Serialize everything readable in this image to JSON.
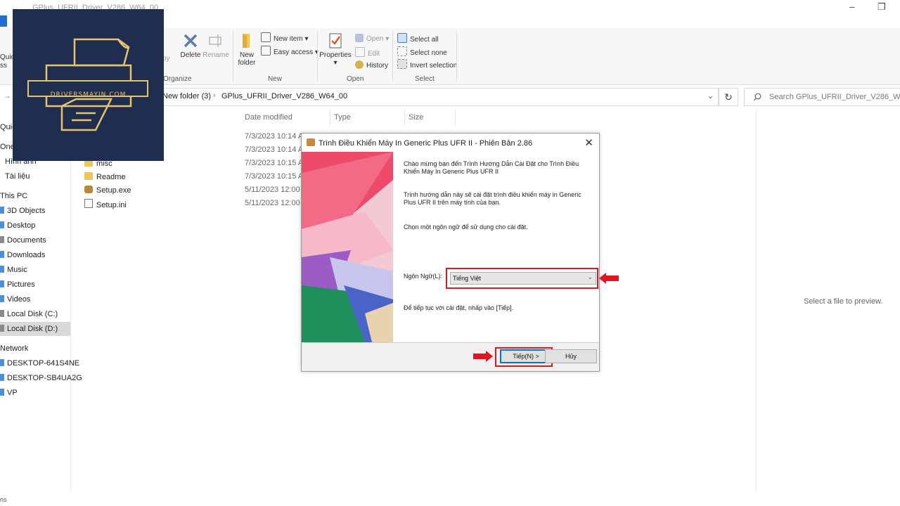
{
  "window": {
    "title": "GPlus_UFRII_Driver_V286_W64_00"
  },
  "ribbon": {
    "groups": {
      "organize": "Organize",
      "new": "New",
      "open": "Open",
      "select": "Select"
    },
    "quick_access": "Quick",
    "quick_access_2": "ss",
    "copy_partial": "py",
    "delete": "Delete",
    "rename": "Rename",
    "new_folder_1": "New",
    "new_folder_2": "folder",
    "new_item": "New item",
    "easy_access": "Easy access",
    "properties": "Properties",
    "open": "Open",
    "edit": "Edit",
    "history": "History",
    "select_all": "Select all",
    "select_none": "Select none",
    "invert_selection": "Invert selection"
  },
  "address": {
    "parent": "New folder (3)",
    "current": "GPlus_UFRII_Driver_V286_W64_00",
    "search_placeholder": "Search GPlus_UFRII_Driver_V286_W64_00"
  },
  "nav": {
    "items": [
      {
        "label": "Quic"
      },
      {
        "label": "One"
      },
      {
        "label": "Hình ảnh"
      },
      {
        "label": "Tài liệu"
      },
      {
        "label": "This PC"
      },
      {
        "label": "3D Objects"
      },
      {
        "label": "Desktop"
      },
      {
        "label": "Documents"
      },
      {
        "label": "Downloads"
      },
      {
        "label": "Music"
      },
      {
        "label": "Pictures"
      },
      {
        "label": "Videos"
      },
      {
        "label": "Local Disk (C:)"
      },
      {
        "label": "Local Disk (D:)"
      },
      {
        "label": "Network"
      },
      {
        "label": "DESKTOP-641S4NE"
      },
      {
        "label": "DESKTOP-SB4UA2G"
      },
      {
        "label": "VP"
      }
    ]
  },
  "files": {
    "columns": {
      "date": "Date modified",
      "type": "Type",
      "size": "Size"
    },
    "rows": [
      {
        "name": "",
        "date": "7/3/2023 10:14 A"
      },
      {
        "name": "",
        "date": "7/3/2023 10:14 A"
      },
      {
        "name": "misc",
        "date": "7/3/2023 10:15 A"
      },
      {
        "name": "Readme",
        "date": "7/3/2023 10:15 A"
      },
      {
        "name": "Setup.exe",
        "date": "5/11/2023 12:00 A"
      },
      {
        "name": "Setup.ini",
        "date": "5/11/2023 12:00 A"
      }
    ]
  },
  "preview": {
    "text": "Select a file to preview."
  },
  "status": {
    "text": "ns"
  },
  "logo": {
    "text": "DRIVERSMAYIN.COM"
  },
  "dialog": {
    "title": "Trình Điều Khiển Máy In Generic Plus UFR II - Phiên Bản 2.86",
    "welcome": "Chào mừng bạn đến Trình Hướng Dẫn Cài Đặt cho Trình Điều Khiển Máy In Generic Plus UFR II",
    "desc": "Trình hướng dẫn này sẽ cài đặt trình điều khiển máy in Generic Plus UFR II trên máy tính của bạn.",
    "choose": "Chọn một ngôn ngữ để sử dụng cho cài đặt.",
    "lang_label": "Ngôn Ngữ(L):",
    "lang_value": "Tiếng Việt",
    "continue": "Để tiếp tục với cài đặt, nhấp vào [Tiếp].",
    "next_button": "Tiếp(N) >",
    "cancel_button": "Hủy"
  },
  "colors": {
    "highlight": "#e3141f",
    "logo_bg": "#1f2d4e",
    "logo_gold": "#e7c36b",
    "folder": "#f1c655",
    "accent": "#0078d7"
  }
}
